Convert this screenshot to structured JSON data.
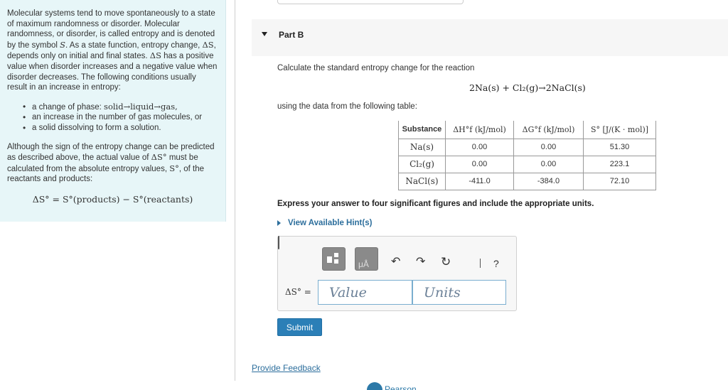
{
  "left_panel": {
    "intro": "Molecular systems tend to move spontaneously to a state of maximum randomness or disorder. Molecular randomness, or disorder, is called entropy and is denoted by the symbol",
    "symbol_S": "S",
    "intro_mid": ". As a state function, entropy change,",
    "symbol_dS": "ΔS",
    "intro_end": ", depends only on initial and final states.",
    "para2_symbol": "ΔS",
    "para2": "has a positive value when disorder increases and a negative value when disorder decreases. The following conditions usually result in an increase in entropy:",
    "bullets": [
      "a change of phase:",
      "an increase in the number of gas molecules, or",
      "a solid dissolving to form a solution."
    ],
    "phase_change": "solid→liquid→gas,",
    "para3_a": "Although the sign of the entropy change can be predicted as described above, the actual value of",
    "para3_sym1": "ΔS°",
    "para3_b": "must be calculated from the absolute entropy values,",
    "para3_sym2": "S°",
    "para3_c": ", of the reactants and products:",
    "formula": "ΔS° = S°(products) − S°(reactants)"
  },
  "part": {
    "title": "Part B"
  },
  "question": {
    "prompt": "Calculate the standard entropy change for the reaction",
    "reaction": "2Na(s) + Cl₂(g)→2NaCl(s)",
    "table_intro": "using the data from the following table:"
  },
  "table": {
    "headers": [
      "Substance",
      "ΔH°f (kJ/mol)",
      "ΔG°f (kJ/mol)",
      "S° [J/(K · mol)]"
    ],
    "rows": [
      [
        "Na(s)",
        "0.00",
        "0.00",
        "51.30"
      ],
      [
        "Cl₂(g)",
        "0.00",
        "0.00",
        "223.1"
      ],
      [
        "NaCl(s)",
        "-411.0",
        "-384.0",
        "72.10"
      ]
    ]
  },
  "instruction": "Express your answer to four significant figures and include the appropriate units.",
  "hint_link": "View Available Hint(s)",
  "answer": {
    "label": "ΔS° =",
    "value_placeholder": "Value",
    "units_placeholder": "Units",
    "undo_icon": "↶",
    "redo_icon": "↷",
    "reset_icon": "↻",
    "help_icon": "?"
  },
  "submit_label": "Submit",
  "feedback_link": "Provide Feedback",
  "footer_brand": "Pearson"
}
